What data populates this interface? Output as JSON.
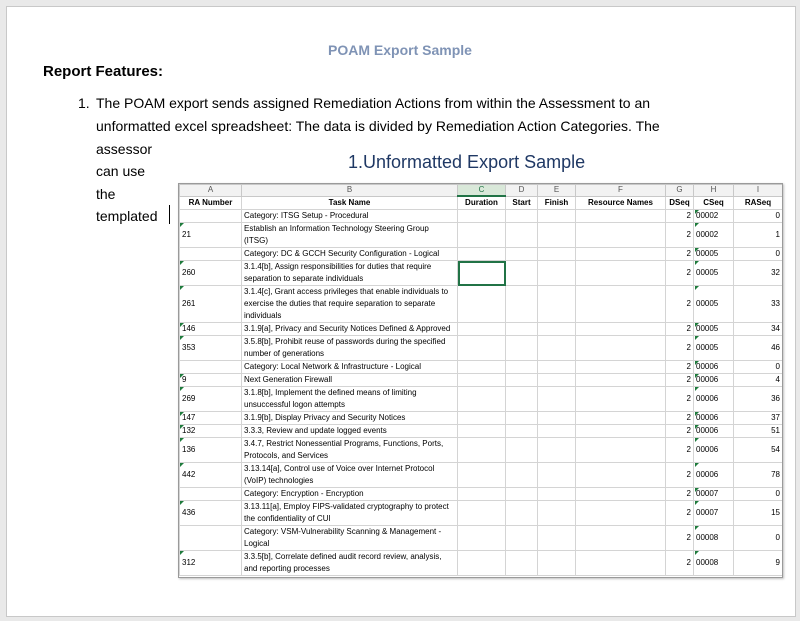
{
  "document": {
    "title": "POAM Export Sample",
    "heading": "Report Features:",
    "list_item_number": "1.",
    "paragraph_lines": [
      "The POAM export sends assigned Remediation Actions from within the Assessment to an",
      "unformatted excel spreadsheet: The data is divided by Remediation Action Categories.  The",
      "assessor",
      "can use",
      "the",
      "templated"
    ],
    "figure_caption": "1.Unformatted Export Sample"
  },
  "sheet": {
    "column_letters": [
      "A",
      "B",
      "C",
      "D",
      "E",
      "F",
      "G",
      "H",
      "I"
    ],
    "headers": [
      "RA Number",
      "Task Name",
      "Duration",
      "Start",
      "Finish",
      "Resource Names",
      "DSeq",
      "CSeq",
      "RASeq"
    ],
    "rows": [
      {
        "ra": "",
        "task": "Category: ITSG Setup - Procedural",
        "dseq": "2",
        "cseq": "00002",
        "raseq": "0"
      },
      {
        "ra": "21",
        "task": "Establish an Information Technology Steering Group (ITSG)",
        "dseq": "2",
        "cseq": "00002",
        "raseq": "1"
      },
      {
        "ra": "",
        "task": "Category: DC & GCCH Security Configuration - Logical",
        "dseq": "2",
        "cseq": "00005",
        "raseq": "0"
      },
      {
        "ra": "260",
        "task": "3.1.4[b], Assign responsibilities for duties that require separation to separate individuals",
        "dseq": "2",
        "cseq": "00005",
        "raseq": "32"
      },
      {
        "ra": "261",
        "task": "3.1.4[c], Grant access privileges that enable individuals to exercise the duties that require separation to separate individuals",
        "dseq": "2",
        "cseq": "00005",
        "raseq": "33"
      },
      {
        "ra": "146",
        "task": "3.1.9[a], Privacy and Security Notices Defined & Approved",
        "dseq": "2",
        "cseq": "00005",
        "raseq": "34"
      },
      {
        "ra": "353",
        "task": "3.5.8[b], Prohibit reuse of passwords during the specified number of generations",
        "dseq": "2",
        "cseq": "00005",
        "raseq": "46"
      },
      {
        "ra": "",
        "task": "Category: Local Network & Infrastructure - Logical",
        "dseq": "2",
        "cseq": "00006",
        "raseq": "0"
      },
      {
        "ra": "9",
        "task": "Next Generation Firewall",
        "dseq": "2",
        "cseq": "00006",
        "raseq": "4"
      },
      {
        "ra": "269",
        "task": "3.1.8[b], Implement the defined means of limiting unsuccessful logon attempts",
        "dseq": "2",
        "cseq": "00006",
        "raseq": "36"
      },
      {
        "ra": "147",
        "task": "3.1.9[b], Display Privacy and Security Notices",
        "dseq": "2",
        "cseq": "00006",
        "raseq": "37"
      },
      {
        "ra": "132",
        "task": "3.3.3, Review and update logged events",
        "dseq": "2",
        "cseq": "00006",
        "raseq": "51"
      },
      {
        "ra": "136",
        "task": "3.4.7, Restrict Nonessential Programs, Functions, Ports, Protocols, and Services",
        "dseq": "2",
        "cseq": "00006",
        "raseq": "54"
      },
      {
        "ra": "442",
        "task": "3.13.14[a], Control use of Voice over Internet Protocol (VoIP) technologies",
        "dseq": "2",
        "cseq": "00006",
        "raseq": "78"
      },
      {
        "ra": "",
        "task": "Category: Encryption - Encryption",
        "dseq": "2",
        "cseq": "00007",
        "raseq": "0"
      },
      {
        "ra": "436",
        "task": "3.13.11[a], Employ FIPS-validated cryptography to protect the confidentiality of CUI",
        "dseq": "2",
        "cseq": "00007",
        "raseq": "15"
      },
      {
        "ra": "",
        "task": "Category: VSM-Vulnerability Scanning & Management - Logical",
        "dseq": "2",
        "cseq": "00008",
        "raseq": "0"
      },
      {
        "ra": "312",
        "task": "3.3.5[b], Correlate defined audit record review, analysis, and reporting processes",
        "dseq": "2",
        "cseq": "00008",
        "raseq": "9"
      }
    ]
  }
}
